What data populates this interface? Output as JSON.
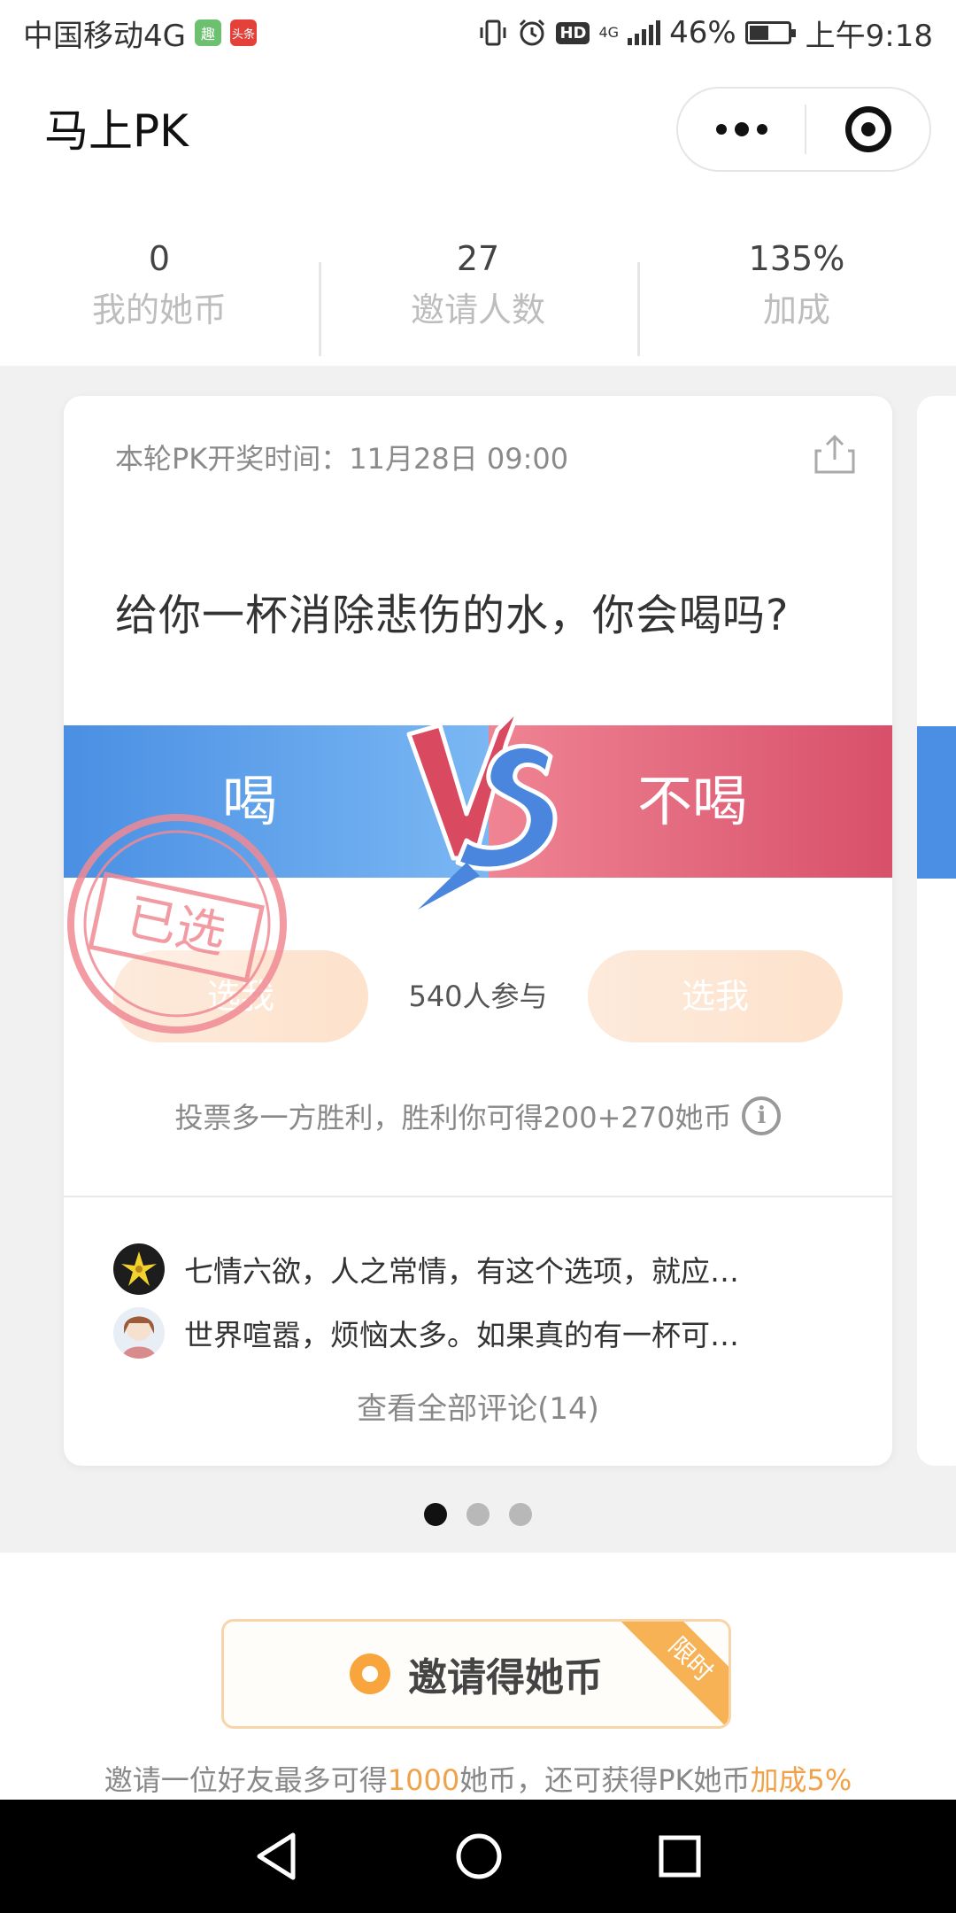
{
  "status_bar": {
    "carrier": "中国移动4G",
    "app_badge_1": "趣",
    "app_badge_2": "头条",
    "network": "4G",
    "hd": "HD",
    "battery": "46%",
    "time": "上午9:18"
  },
  "nav": {
    "title": "马上PK"
  },
  "stats": [
    {
      "value": "0",
      "label": "我的她币"
    },
    {
      "value": "27",
      "label": "邀请人数"
    },
    {
      "value": "135%",
      "label": "加成"
    }
  ],
  "card": {
    "draw_time": "本轮PK开奖时间：11月28日 09:00",
    "question": "给你一杯消除悲伤的水，你会喝吗?",
    "option_left": "喝",
    "option_right": "不喝",
    "vote_left": "选我",
    "vote_right": "选我",
    "participants": "540人参与",
    "stamp": "已选",
    "rule": "投票多一方胜利，胜利你可得200+270她币",
    "comments": [
      {
        "text": "七情六欲，人之常情，有这个选项，就应…"
      },
      {
        "text": "世界喧嚣，烦恼太多。如果真的有一杯可…"
      }
    ],
    "view_all": "查看全部评论(14)"
  },
  "carousel": {
    "count": 3,
    "active": 0
  },
  "invite": {
    "button_label": "邀请得她币",
    "ribbon": "限时",
    "note_prefix": "邀请一位好友最多可得",
    "note_amount": "1000",
    "note_middle": "她币，还可获得PK她币",
    "note_bonus": "加成5%"
  },
  "colors": {
    "blue": "#4a8fe3",
    "red": "#d8506a",
    "orange": "#f0a24a",
    "stamp": "#f08a94"
  },
  "icons": [
    "share-icon",
    "info-icon",
    "coin-icon",
    "back-icon",
    "home-icon",
    "recents-icon",
    "more-icon",
    "target-icon"
  ]
}
